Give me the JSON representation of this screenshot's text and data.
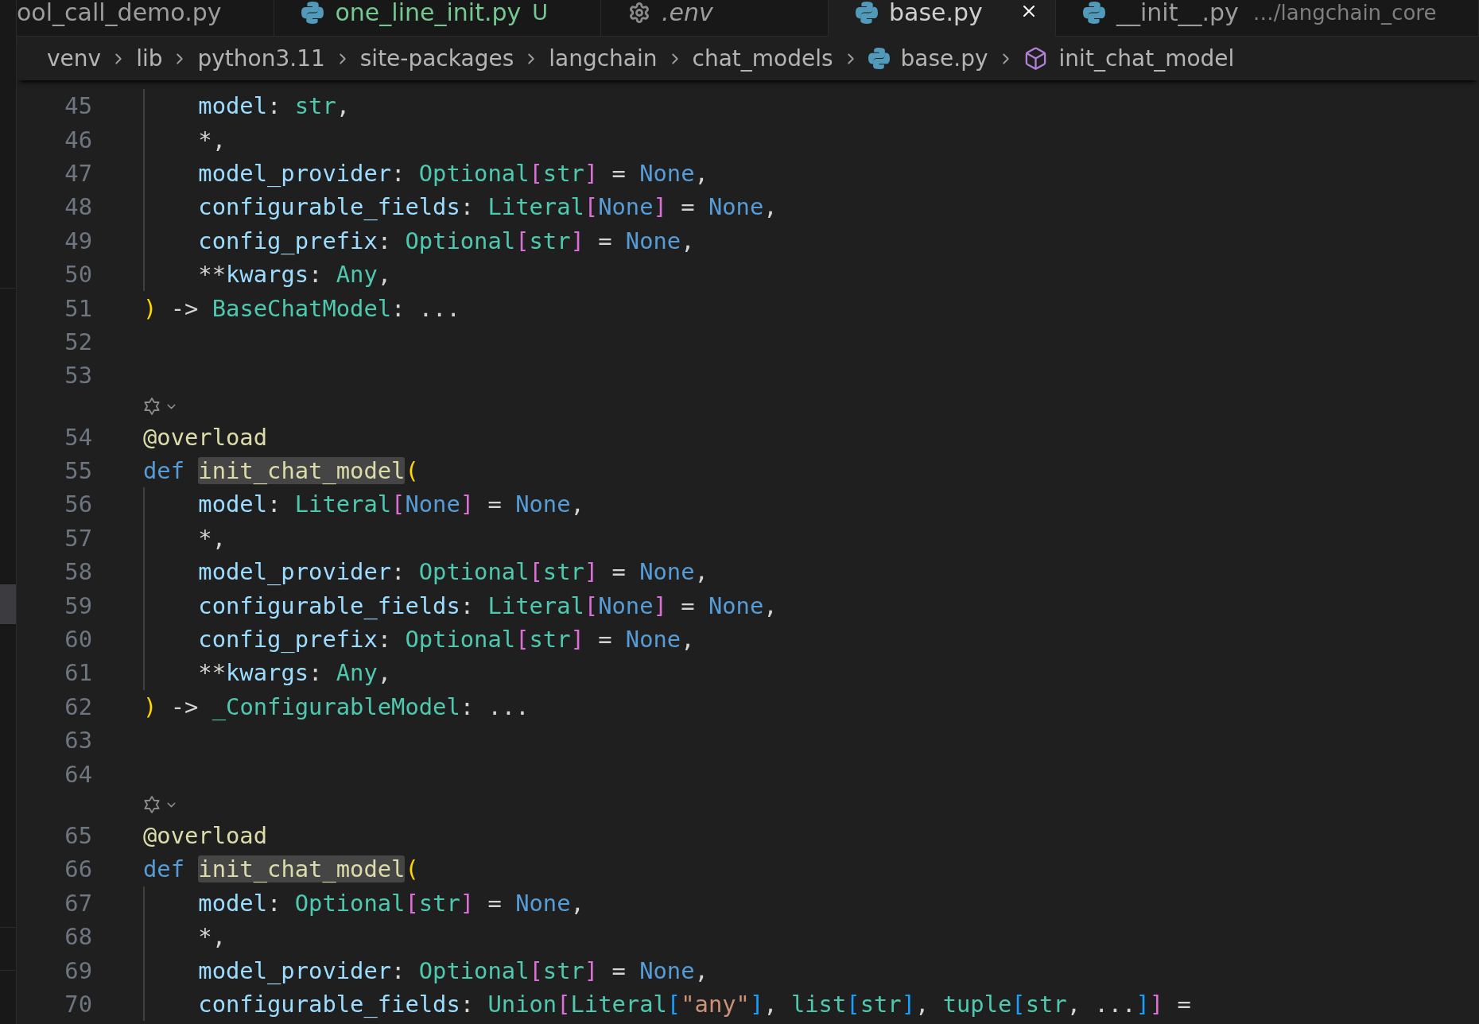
{
  "tabs": [
    {
      "label": "ool_call_demo.py",
      "kind": "text",
      "selected": false,
      "untracked": false,
      "preview": false
    },
    {
      "label": "one_line_init.py",
      "kind": "python",
      "badge": "U",
      "selected": false,
      "untracked": true,
      "preview": false
    },
    {
      "label": ".env",
      "kind": "config",
      "selected": false,
      "untracked": false,
      "preview": true
    },
    {
      "label": "base.py",
      "kind": "python",
      "selected": true,
      "untracked": false,
      "preview": false
    },
    {
      "label": "__init__.py",
      "kind": "python",
      "description": "…/langchain_core",
      "selected": false,
      "untracked": false,
      "preview": false
    }
  ],
  "breadcrumbs": [
    {
      "label": "venv",
      "kind": "folder"
    },
    {
      "label": "lib",
      "kind": "folder"
    },
    {
      "label": "python3.11",
      "kind": "folder"
    },
    {
      "label": "site-packages",
      "kind": "folder"
    },
    {
      "label": "langchain",
      "kind": "folder"
    },
    {
      "label": "chat_models",
      "kind": "folder"
    },
    {
      "label": "base.py",
      "kind": "file"
    },
    {
      "label": "init_chat_model",
      "kind": "symbol"
    }
  ],
  "editor": {
    "lines": [
      {
        "kind": "code",
        "number": "45",
        "indented": true,
        "tokens": [
          {
            "text": "model",
            "kind": "param"
          },
          {
            "text": ": ",
            "kind": "plain"
          },
          {
            "text": "str",
            "kind": "type"
          },
          {
            "text": ",",
            "kind": "plain"
          }
        ]
      },
      {
        "kind": "code",
        "number": "46",
        "indented": true,
        "tokens": [
          {
            "text": "*,",
            "kind": "plain"
          }
        ]
      },
      {
        "kind": "code",
        "number": "47",
        "indented": true,
        "tokens": [
          {
            "text": "model_provider",
            "kind": "param"
          },
          {
            "text": ": ",
            "kind": "plain"
          },
          {
            "text": "Optional",
            "kind": "type"
          },
          {
            "text": "[",
            "kind": "bracket2"
          },
          {
            "text": "str",
            "kind": "type"
          },
          {
            "text": "]",
            "kind": "bracket2"
          },
          {
            "text": " = ",
            "kind": "plain"
          },
          {
            "text": "None",
            "kind": "keyword"
          },
          {
            "text": ",",
            "kind": "plain"
          }
        ]
      },
      {
        "kind": "code",
        "number": "48",
        "indented": true,
        "tokens": [
          {
            "text": "configurable_fields",
            "kind": "param"
          },
          {
            "text": ": ",
            "kind": "plain"
          },
          {
            "text": "Literal",
            "kind": "type"
          },
          {
            "text": "[",
            "kind": "bracket2"
          },
          {
            "text": "None",
            "kind": "keyword"
          },
          {
            "text": "]",
            "kind": "bracket2"
          },
          {
            "text": " = ",
            "kind": "plain"
          },
          {
            "text": "None",
            "kind": "keyword"
          },
          {
            "text": ",",
            "kind": "plain"
          }
        ]
      },
      {
        "kind": "code",
        "number": "49",
        "indented": true,
        "tokens": [
          {
            "text": "config_prefix",
            "kind": "param"
          },
          {
            "text": ": ",
            "kind": "plain"
          },
          {
            "text": "Optional",
            "kind": "type"
          },
          {
            "text": "[",
            "kind": "bracket2"
          },
          {
            "text": "str",
            "kind": "type"
          },
          {
            "text": "]",
            "kind": "bracket2"
          },
          {
            "text": " = ",
            "kind": "plain"
          },
          {
            "text": "None",
            "kind": "keyword"
          },
          {
            "text": ",",
            "kind": "plain"
          }
        ]
      },
      {
        "kind": "code",
        "number": "50",
        "indented": true,
        "tokens": [
          {
            "text": "**",
            "kind": "plain"
          },
          {
            "text": "kwargs",
            "kind": "param"
          },
          {
            "text": ": ",
            "kind": "plain"
          },
          {
            "text": "Any",
            "kind": "type"
          },
          {
            "text": ",",
            "kind": "plain"
          }
        ]
      },
      {
        "kind": "code",
        "number": "51",
        "indented": false,
        "tokens": [
          {
            "text": ")",
            "kind": "bracket1"
          },
          {
            "text": " -> ",
            "kind": "plain"
          },
          {
            "text": "BaseChatModel",
            "kind": "type"
          },
          {
            "text": ": ...",
            "kind": "plain"
          }
        ]
      },
      {
        "kind": "code",
        "number": "52"
      },
      {
        "kind": "code",
        "number": "53"
      },
      {
        "kind": "codelens"
      },
      {
        "kind": "code",
        "number": "54",
        "indented": false,
        "tokens": [
          {
            "text": "@overload",
            "kind": "decorator"
          }
        ]
      },
      {
        "kind": "code",
        "number": "55",
        "indented": false,
        "tokens": [
          {
            "text": "def ",
            "kind": "keyword"
          },
          {
            "text": "init_chat_model",
            "kind": "function",
            "highlighted": true
          },
          {
            "text": "(",
            "kind": "bracket1"
          }
        ]
      },
      {
        "kind": "code",
        "number": "56",
        "indented": true,
        "tokens": [
          {
            "text": "model",
            "kind": "param"
          },
          {
            "text": ": ",
            "kind": "plain"
          },
          {
            "text": "Literal",
            "kind": "type"
          },
          {
            "text": "[",
            "kind": "bracket2"
          },
          {
            "text": "None",
            "kind": "keyword"
          },
          {
            "text": "]",
            "kind": "bracket2"
          },
          {
            "text": " = ",
            "kind": "plain"
          },
          {
            "text": "None",
            "kind": "keyword"
          },
          {
            "text": ",",
            "kind": "plain"
          }
        ]
      },
      {
        "kind": "code",
        "number": "57",
        "indented": true,
        "tokens": [
          {
            "text": "*,",
            "kind": "plain"
          }
        ]
      },
      {
        "kind": "code",
        "number": "58",
        "indented": true,
        "tokens": [
          {
            "text": "model_provider",
            "kind": "param"
          },
          {
            "text": ": ",
            "kind": "plain"
          },
          {
            "text": "Optional",
            "kind": "type"
          },
          {
            "text": "[",
            "kind": "bracket2"
          },
          {
            "text": "str",
            "kind": "type"
          },
          {
            "text": "]",
            "kind": "bracket2"
          },
          {
            "text": " = ",
            "kind": "plain"
          },
          {
            "text": "None",
            "kind": "keyword"
          },
          {
            "text": ",",
            "kind": "plain"
          }
        ]
      },
      {
        "kind": "code",
        "number": "59",
        "indented": true,
        "tokens": [
          {
            "text": "configurable_fields",
            "kind": "param"
          },
          {
            "text": ": ",
            "kind": "plain"
          },
          {
            "text": "Literal",
            "kind": "type"
          },
          {
            "text": "[",
            "kind": "bracket2"
          },
          {
            "text": "None",
            "kind": "keyword"
          },
          {
            "text": "]",
            "kind": "bracket2"
          },
          {
            "text": " = ",
            "kind": "plain"
          },
          {
            "text": "None",
            "kind": "keyword"
          },
          {
            "text": ",",
            "kind": "plain"
          }
        ]
      },
      {
        "kind": "code",
        "number": "60",
        "indented": true,
        "tokens": [
          {
            "text": "config_prefix",
            "kind": "param"
          },
          {
            "text": ": ",
            "kind": "plain"
          },
          {
            "text": "Optional",
            "kind": "type"
          },
          {
            "text": "[",
            "kind": "bracket2"
          },
          {
            "text": "str",
            "kind": "type"
          },
          {
            "text": "]",
            "kind": "bracket2"
          },
          {
            "text": " = ",
            "kind": "plain"
          },
          {
            "text": "None",
            "kind": "keyword"
          },
          {
            "text": ",",
            "kind": "plain"
          }
        ]
      },
      {
        "kind": "code",
        "number": "61",
        "indented": true,
        "tokens": [
          {
            "text": "**",
            "kind": "plain"
          },
          {
            "text": "kwargs",
            "kind": "param"
          },
          {
            "text": ": ",
            "kind": "plain"
          },
          {
            "text": "Any",
            "kind": "type"
          },
          {
            "text": ",",
            "kind": "plain"
          }
        ]
      },
      {
        "kind": "code",
        "number": "62",
        "indented": false,
        "tokens": [
          {
            "text": ")",
            "kind": "bracket1"
          },
          {
            "text": " -> ",
            "kind": "plain"
          },
          {
            "text": "_ConfigurableModel",
            "kind": "type"
          },
          {
            "text": ": ...",
            "kind": "plain"
          }
        ]
      },
      {
        "kind": "code",
        "number": "63"
      },
      {
        "kind": "code",
        "number": "64"
      },
      {
        "kind": "codelens"
      },
      {
        "kind": "code",
        "number": "65",
        "indented": false,
        "tokens": [
          {
            "text": "@overload",
            "kind": "decorator"
          }
        ]
      },
      {
        "kind": "code",
        "number": "66",
        "indented": false,
        "tokens": [
          {
            "text": "def ",
            "kind": "keyword"
          },
          {
            "text": "init_chat_model",
            "kind": "function",
            "highlighted": true
          },
          {
            "text": "(",
            "kind": "bracket1"
          }
        ]
      },
      {
        "kind": "code",
        "number": "67",
        "indented": true,
        "tokens": [
          {
            "text": "model",
            "kind": "param"
          },
          {
            "text": ": ",
            "kind": "plain"
          },
          {
            "text": "Optional",
            "kind": "type"
          },
          {
            "text": "[",
            "kind": "bracket2"
          },
          {
            "text": "str",
            "kind": "type"
          },
          {
            "text": "]",
            "kind": "bracket2"
          },
          {
            "text": " = ",
            "kind": "plain"
          },
          {
            "text": "None",
            "kind": "keyword"
          },
          {
            "text": ",",
            "kind": "plain"
          }
        ]
      },
      {
        "kind": "code",
        "number": "68",
        "indented": true,
        "tokens": [
          {
            "text": "*,",
            "kind": "plain"
          }
        ]
      },
      {
        "kind": "code",
        "number": "69",
        "indented": true,
        "tokens": [
          {
            "text": "model_provider",
            "kind": "param"
          },
          {
            "text": ": ",
            "kind": "plain"
          },
          {
            "text": "Optional",
            "kind": "type"
          },
          {
            "text": "[",
            "kind": "bracket2"
          },
          {
            "text": "str",
            "kind": "type"
          },
          {
            "text": "]",
            "kind": "bracket2"
          },
          {
            "text": " = ",
            "kind": "plain"
          },
          {
            "text": "None",
            "kind": "keyword"
          },
          {
            "text": ",",
            "kind": "plain"
          }
        ]
      },
      {
        "kind": "code",
        "number": "70",
        "indented": true,
        "tokens": [
          {
            "text": "configurable_fields",
            "kind": "param"
          },
          {
            "text": ": ",
            "kind": "plain"
          },
          {
            "text": "Union",
            "kind": "type"
          },
          {
            "text": "[",
            "kind": "bracket2"
          },
          {
            "text": "Literal",
            "kind": "type"
          },
          {
            "text": "[",
            "kind": "bracket3"
          },
          {
            "text": "\"any\"",
            "kind": "string"
          },
          {
            "text": "]",
            "kind": "bracket3"
          },
          {
            "text": ", ",
            "kind": "plain"
          },
          {
            "text": "list",
            "kind": "type"
          },
          {
            "text": "[",
            "kind": "bracket3"
          },
          {
            "text": "str",
            "kind": "type"
          },
          {
            "text": "]",
            "kind": "bracket3"
          },
          {
            "text": ", ",
            "kind": "plain"
          },
          {
            "text": "tuple",
            "kind": "type"
          },
          {
            "text": "[",
            "kind": "bracket3"
          },
          {
            "text": "str",
            "kind": "type"
          },
          {
            "text": ", ...",
            "kind": "plain"
          },
          {
            "text": "]",
            "kind": "bracket3"
          },
          {
            "text": "]",
            "kind": "bracket2"
          },
          {
            "text": " =",
            "kind": "plain"
          }
        ]
      }
    ]
  }
}
